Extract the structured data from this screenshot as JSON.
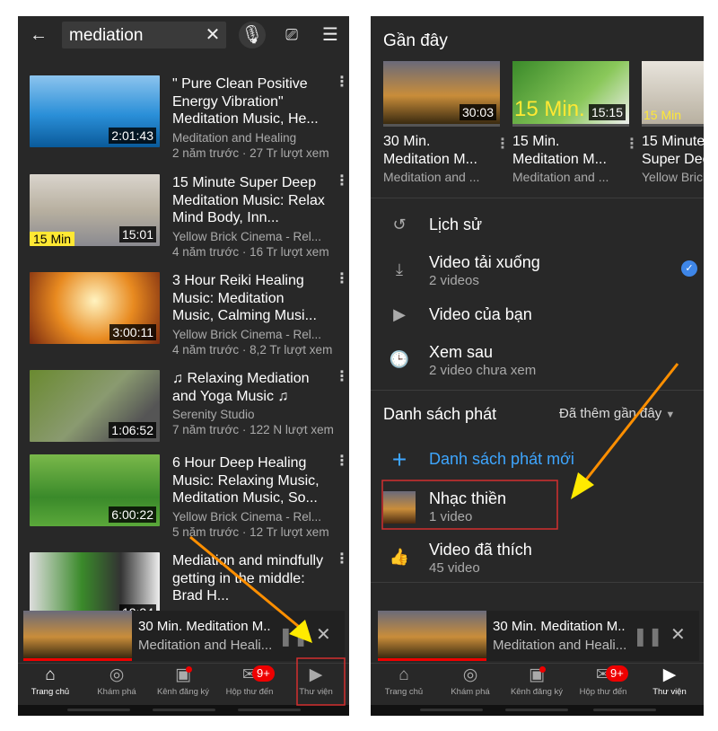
{
  "left": {
    "search": {
      "query": "mediation",
      "back_icon": "arrow-left-icon",
      "clear_icon": "close-icon",
      "mic_icon": "microphone-icon",
      "cast_icon": "cast-icon",
      "filter_icon": "filter-icon"
    },
    "videos": [
      {
        "title": "\" Pure Clean Positive Energy Vibration\" Meditation Music, He...",
        "channel": "Meditation and Healing",
        "meta": "2 năm trước · 27 Tr lượt xem",
        "duration": "2:01:43"
      },
      {
        "title": "15 Minute Super Deep Meditation Music: Relax Mind Body, Inn...",
        "channel": "Yellow Brick Cinema - Rel...",
        "meta": "4 năm trước · 16 Tr lượt xem",
        "duration": "15:01",
        "overlay": "15 Min"
      },
      {
        "title": "3 Hour Reiki Healing Music: Meditation Music, Calming Musi...",
        "channel": "Yellow Brick Cinema - Rel...",
        "meta": "4 năm trước · 8,2 Tr lượt xem",
        "duration": "3:00:11"
      },
      {
        "title": "♫ Relaxing Mediation and Yoga Music ♫",
        "channel": "Serenity Studio",
        "meta": "7 năm trước · 122 N lượt xem",
        "duration": "1:06:52"
      },
      {
        "title": "6 Hour Deep Healing Music: Relaxing Music, Meditation Music, So...",
        "channel": "Yellow Brick Cinema - Rel...",
        "meta": "5 năm trước · 12 Tr lượt xem",
        "duration": "6:00:22"
      },
      {
        "title": "Mediation and mindfully getting in the middle: Brad H...",
        "channel": "",
        "meta": "",
        "duration": "12:34"
      }
    ],
    "miniplayer": {
      "title": "30 Min. Meditation M..",
      "channel": "Meditation and Heali...",
      "pause_icon": "pause-icon",
      "close_icon": "close-icon"
    }
  },
  "right": {
    "recent_title": "Gần đây",
    "recent": [
      {
        "title1": "30 Min.",
        "title2": "Meditation M...",
        "channel": "Meditation and ...",
        "duration": "30:03"
      },
      {
        "title1": "15 Min.",
        "title2": "Meditation M...",
        "channel": "Meditation and ...",
        "duration": "15:15",
        "overlay": "15 Min."
      },
      {
        "title1": "15 Minute",
        "title2": "Super Deep",
        "channel": "Yellow Brick",
        "overlay": "15 Min"
      }
    ],
    "menu": [
      {
        "label": "Lịch sử",
        "icon": "history-icon"
      },
      {
        "label": "Video tải xuống",
        "sub": "2 videos",
        "icon": "download-icon"
      },
      {
        "label": "Video của bạn",
        "icon": "play-square-icon"
      },
      {
        "label": "Xem sau",
        "sub": "2 video chưa xem",
        "icon": "clock-icon"
      }
    ],
    "playlists_title": "Danh sách phát",
    "sort_label": "Đã thêm gần đây",
    "new_playlist": "Danh sách phát mới",
    "playlists": [
      {
        "label": "Nhạc thiền",
        "sub": "1 video"
      },
      {
        "label": "Video đã thích",
        "sub": "45 video",
        "icon": "thumbs-up-icon"
      }
    ],
    "miniplayer": {
      "title": "30 Min. Meditation M..",
      "channel": "Meditation and Heali..."
    }
  },
  "nav": [
    {
      "label": "Trang chủ",
      "icon": "home-icon"
    },
    {
      "label": "Khám phá",
      "icon": "compass-icon"
    },
    {
      "label": "Kênh đăng ký",
      "icon": "subscriptions-icon"
    },
    {
      "label": "Hộp thư đến",
      "icon": "inbox-icon",
      "badge": "9+"
    },
    {
      "label": "Thư viện",
      "icon": "library-icon"
    }
  ],
  "colors": {
    "background": "#282828",
    "accent_blue": "#3ea6ff",
    "badge_red": "#e00000",
    "annotation_arrow": "#ff9800",
    "annotation_box": "#d32f2f"
  }
}
